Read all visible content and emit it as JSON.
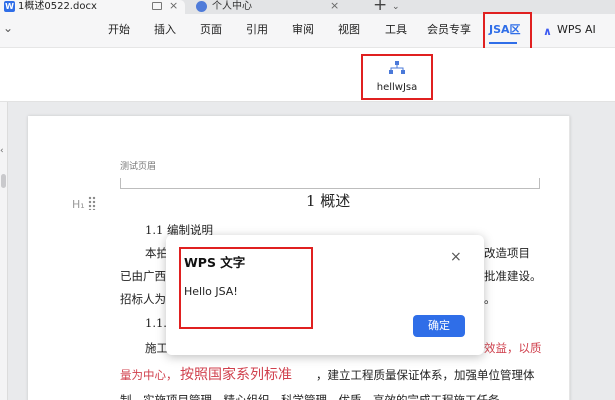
{
  "tabs": {
    "doc_title": "1概述0522.docx",
    "user_title": "个人中心",
    "new_tab": "+",
    "close": "×",
    "chevron": "⌄"
  },
  "ribbon": {
    "chevron": "⌄",
    "items": [
      "开始",
      "插入",
      "页面",
      "引用",
      "审阅",
      "视图",
      "工具",
      "会员专享",
      "JSA区",
      "WPS AI"
    ],
    "active": "JSA区"
  },
  "toolbar": {
    "button_label": "hellwJsa"
  },
  "document": {
    "header": "测试页眉",
    "heading": "1 概述",
    "hi": "H₁",
    "lines": [
      "1.1 编制说明",
      "本拍",
      "改造项目",
      "已由广西",
      "批准建设。",
      "招标人为",
      "。",
      "1.1.",
      "施工",
      "效益，以质",
      "量为中心，",
      "按照国家系列标准",
      "，建立工程质量保证体系，加强单位管理体",
      "制，实施项目管理，精心组织，科学管理，优质、高效的完成工程施工任务"
    ]
  },
  "dialog": {
    "title": "WPS 文字",
    "message": "Hello JSA!",
    "ok": "确定",
    "close": "×"
  },
  "colors": {
    "accent": "#2f6ee8",
    "highlight_box": "#e02020",
    "doc_red_text": "#d0404d"
  }
}
